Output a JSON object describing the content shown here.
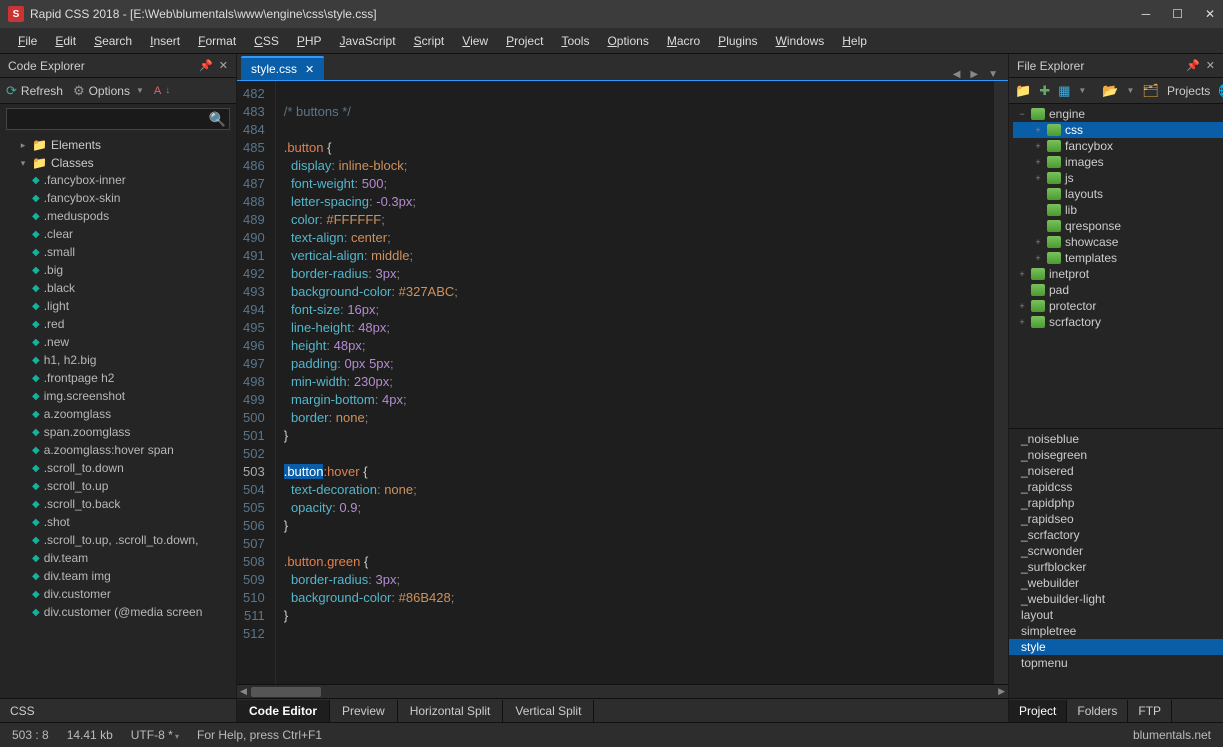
{
  "title": "Rapid CSS 2018 - [E:\\Web\\blumentals\\www\\engine\\css\\style.css]",
  "menus": [
    "File",
    "Edit",
    "Search",
    "Insert",
    "Format",
    "CSS",
    "PHP",
    "JavaScript",
    "Script",
    "View",
    "Project",
    "Tools",
    "Options",
    "Macro",
    "Plugins",
    "Windows",
    "Help"
  ],
  "codeExplorer": {
    "title": "Code Explorer",
    "refresh": "Refresh",
    "options": "Options",
    "searchPlaceholder": "",
    "roots": [
      {
        "label": "Elements",
        "open": false
      },
      {
        "label": "Classes",
        "open": true
      }
    ],
    "classes": [
      ".fancybox-inner",
      ".fancybox-skin",
      ".meduspods",
      ".clear",
      ".small",
      ".big",
      ".black",
      ".light",
      ".red",
      ".new",
      "h1, h2.big",
      ".frontpage h2",
      "img.screenshot",
      "a.zoomglass",
      "span.zoomglass",
      "a.zoomglass:hover span",
      ".scroll_to.down",
      ".scroll_to.up",
      ".scroll_to.back",
      ".shot",
      ".scroll_to.up, .scroll_to.down,",
      "div.team",
      "div.team img",
      "div.customer",
      "div.customer (@media screen"
    ],
    "bottomTab": "CSS"
  },
  "editorTab": {
    "name": "style.css"
  },
  "gutterStart": 482,
  "gutterEnd": 512,
  "currentLine": 503,
  "code": [
    {
      "t": "blank"
    },
    {
      "t": "cm",
      "txt": "/* buttons */"
    },
    {
      "t": "blank"
    },
    {
      "t": "open",
      "sel": ".button"
    },
    {
      "t": "decl",
      "prop": "display",
      "val": "inline-block"
    },
    {
      "t": "decl",
      "prop": "font-weight",
      "num": "500"
    },
    {
      "t": "decl",
      "prop": "letter-spacing",
      "num": "-0.3px"
    },
    {
      "t": "decl",
      "prop": "color",
      "val": "#FFFFFF"
    },
    {
      "t": "decl",
      "prop": "text-align",
      "val": "center"
    },
    {
      "t": "decl",
      "prop": "vertical-align",
      "val": "middle"
    },
    {
      "t": "decl",
      "prop": "border-radius",
      "num": "3px"
    },
    {
      "t": "decl",
      "prop": "background-color",
      "val": "#327ABC"
    },
    {
      "t": "decl",
      "prop": "font-size",
      "num": "16px"
    },
    {
      "t": "decl",
      "prop": "line-height",
      "num": "48px"
    },
    {
      "t": "decl",
      "prop": "height",
      "num": "48px"
    },
    {
      "t": "decl2",
      "prop": "padding",
      "n1": "0px",
      "n2": "5px"
    },
    {
      "t": "decl",
      "prop": "min-width",
      "num": "230px"
    },
    {
      "t": "decl",
      "prop": "margin-bottom",
      "num": "4px"
    },
    {
      "t": "decl",
      "prop": "border",
      "val": "none"
    },
    {
      "t": "close"
    },
    {
      "t": "blank"
    },
    {
      "t": "openhl",
      "selhl": ".button",
      "rest": ":hover"
    },
    {
      "t": "decl",
      "prop": "text-decoration",
      "val": "none"
    },
    {
      "t": "decl",
      "prop": "opacity",
      "num": "0.9"
    },
    {
      "t": "close"
    },
    {
      "t": "blank"
    },
    {
      "t": "open",
      "sel": ".button.green"
    },
    {
      "t": "decl",
      "prop": "border-radius",
      "num": "3px"
    },
    {
      "t": "decl",
      "prop": "background-color",
      "val": "#86B428"
    },
    {
      "t": "close"
    },
    {
      "t": "blank"
    }
  ],
  "bottom": {
    "tabs": [
      "Code Editor",
      "Preview",
      "Horizontal Split",
      "Vertical Split"
    ],
    "active": 0
  },
  "fileExplorer": {
    "title": "File Explorer",
    "projects": "Projects",
    "tree": [
      {
        "label": "engine",
        "lvl": 0,
        "exp": "−",
        "open": true
      },
      {
        "label": "css",
        "lvl": 1,
        "exp": "+",
        "sel": true
      },
      {
        "label": "fancybox",
        "lvl": 1,
        "exp": "+"
      },
      {
        "label": "images",
        "lvl": 1,
        "exp": "+"
      },
      {
        "label": "js",
        "lvl": 1,
        "exp": "+"
      },
      {
        "label": "layouts",
        "lvl": 1,
        "exp": ""
      },
      {
        "label": "lib",
        "lvl": 1,
        "exp": ""
      },
      {
        "label": "qresponse",
        "lvl": 1,
        "exp": ""
      },
      {
        "label": "showcase",
        "lvl": 1,
        "exp": "+"
      },
      {
        "label": "templates",
        "lvl": 1,
        "exp": "+"
      },
      {
        "label": "inetprot",
        "lvl": 0,
        "exp": "+"
      },
      {
        "label": "pad",
        "lvl": 0,
        "exp": ""
      },
      {
        "label": "protector",
        "lvl": 0,
        "exp": "+"
      },
      {
        "label": "scrfactory",
        "lvl": 0,
        "exp": "+"
      }
    ],
    "files": [
      "_noiseblue",
      "_noisegreen",
      "_noisered",
      "_rapidcss",
      "_rapidphp",
      "_rapidseo",
      "_scrfactory",
      "_scrwonder",
      "_surfblocker",
      "_webuilder",
      "_webuilder-light",
      "layout",
      "simpletree",
      "style",
      "topmenu"
    ],
    "fileSelected": "style",
    "bottomTabs": [
      "Project",
      "Folders",
      "FTP"
    ],
    "bottomActive": 0
  },
  "status": {
    "pos": "503 : 8",
    "size": "14.41 kb",
    "enc": "UTF-8 *",
    "hint": "For Help, press Ctrl+F1",
    "brand": "blumentals.net"
  }
}
